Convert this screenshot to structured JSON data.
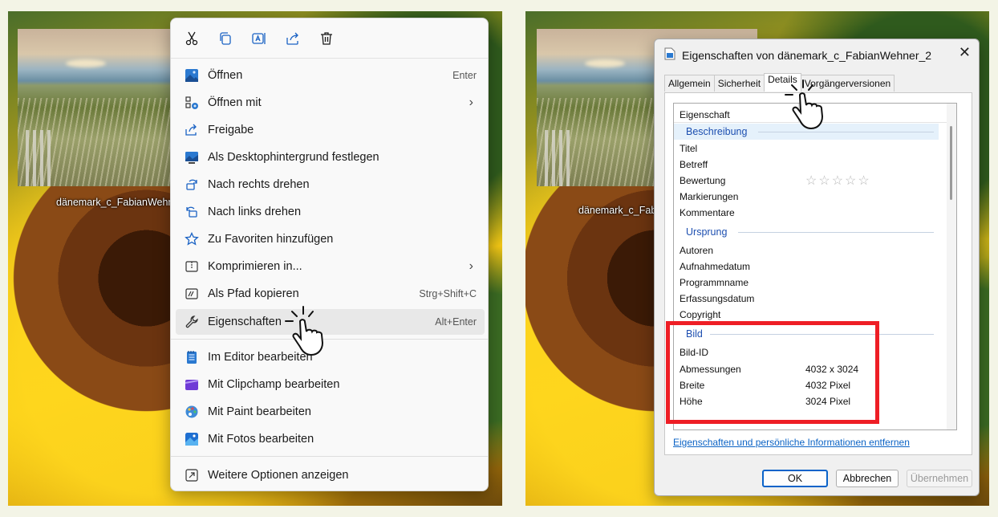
{
  "left_panel": {
    "file_name": "dänemark_c_FabianWehner_2",
    "context_menu": {
      "toolbar": [
        {
          "icon": "cut-icon"
        },
        {
          "icon": "copy-icon"
        },
        {
          "icon": "rename-icon"
        },
        {
          "icon": "share-icon"
        },
        {
          "icon": "delete-icon"
        }
      ],
      "items": [
        {
          "label": "Öffnen",
          "shortcut": "Enter",
          "icon": "image-icon"
        },
        {
          "label": "Öffnen mit",
          "shortcut": "",
          "icon": "open-with-icon",
          "submenu": true
        },
        {
          "label": "Freigabe",
          "shortcut": "",
          "icon": "share-icon"
        },
        {
          "label": "Als Desktophintergrund festlegen",
          "shortcut": "",
          "icon": "desktop-background-icon"
        },
        {
          "label": "Nach rechts drehen",
          "shortcut": "",
          "icon": "rotate-right-icon"
        },
        {
          "label": "Nach links drehen",
          "shortcut": "",
          "icon": "rotate-left-icon"
        },
        {
          "label": "Zu Favoriten hinzufügen",
          "shortcut": "",
          "icon": "star-icon"
        },
        {
          "label": "Komprimieren in...",
          "shortcut": "",
          "icon": "compress-icon",
          "submenu": true
        },
        {
          "label": "Als Pfad kopieren",
          "shortcut": "Strg+Shift+C",
          "icon": "copy-path-icon"
        },
        {
          "label": "Eigenschaften",
          "shortcut": "Alt+Enter",
          "icon": "wrench-icon",
          "highlighted": true
        },
        {
          "label": "Im Editor bearbeiten",
          "shortcut": "",
          "icon": "notepad-icon"
        },
        {
          "label": "Mit Clipchamp bearbeiten",
          "shortcut": "",
          "icon": "clipchamp-icon"
        },
        {
          "label": "Mit Paint bearbeiten",
          "shortcut": "",
          "icon": "paint-icon"
        },
        {
          "label": "Mit Fotos bearbeiten",
          "shortcut": "",
          "icon": "photos-icon"
        },
        {
          "label": "Weitere Optionen anzeigen",
          "shortcut": "",
          "icon": "more-options-icon"
        }
      ]
    }
  },
  "right_panel": {
    "file_name": "dänemark_c_FabianWehner_",
    "dialog": {
      "title": "Eigenschaften von dänemark_c_FabianWehner_2",
      "tabs": [
        "Allgemein",
        "Sicherheit",
        "Details",
        "Vorgängerversionen"
      ],
      "active_tab": "Details",
      "column_header": "Eigenschaft",
      "groups": [
        {
          "title": "Beschreibung",
          "rows": [
            {
              "label": "Titel",
              "value": ""
            },
            {
              "label": "Betreff",
              "value": ""
            },
            {
              "label": "Bewertung",
              "value": "☆☆☆☆☆"
            },
            {
              "label": "Markierungen",
              "value": ""
            },
            {
              "label": "Kommentare",
              "value": ""
            }
          ]
        },
        {
          "title": "Ursprung",
          "rows": [
            {
              "label": "Autoren",
              "value": ""
            },
            {
              "label": "Aufnahmedatum",
              "value": ""
            },
            {
              "label": "Programmname",
              "value": ""
            },
            {
              "label": "Erfassungsdatum",
              "value": ""
            },
            {
              "label": "Copyright",
              "value": ""
            }
          ]
        },
        {
          "title": "Bild",
          "rows": [
            {
              "label": "Bild-ID",
              "value": ""
            },
            {
              "label": "Abmessungen",
              "value": "4032 x 3024"
            },
            {
              "label": "Breite",
              "value": "4032 Pixel"
            },
            {
              "label": "Höhe",
              "value": "3024 Pixel"
            }
          ]
        }
      ],
      "link": "Eigenschaften und persönliche Informationen entfernen",
      "buttons": {
        "ok": "OK",
        "cancel": "Abbrechen",
        "apply": "Übernehmen"
      }
    }
  },
  "colors": {
    "highlight_box": "#ee1e25",
    "link": "#0b63c5",
    "group_heading": "#1d4fb0"
  }
}
